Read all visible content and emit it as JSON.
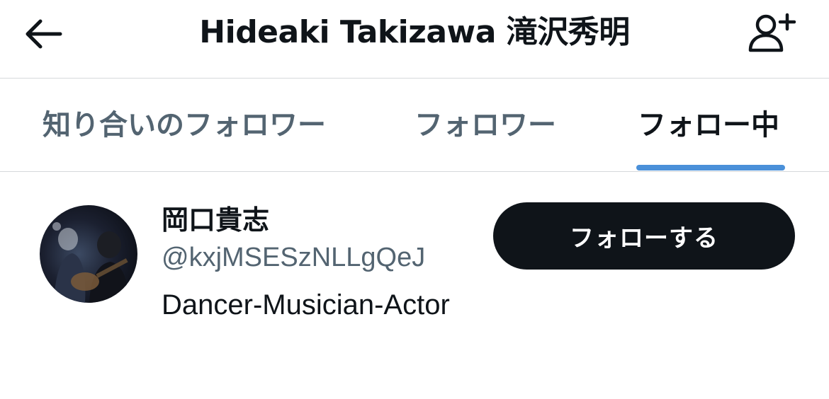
{
  "header": {
    "title": "Hideaki Takizawa 滝沢秀明",
    "back_icon": "arrow-left-icon",
    "add_icon": "person-add-icon"
  },
  "tabs": [
    {
      "label": "知り合いのフォロワー",
      "active": false
    },
    {
      "label": "フォロワー",
      "active": false
    },
    {
      "label": "フォロー中",
      "active": true
    }
  ],
  "accent_color": "#4a90d9",
  "users": [
    {
      "name": "岡口貴志",
      "handle": "@kxjMSESzNLLgQeJ",
      "bio": "Dancer-Musician-Actor",
      "follow_label": "フォローする"
    }
  ]
}
